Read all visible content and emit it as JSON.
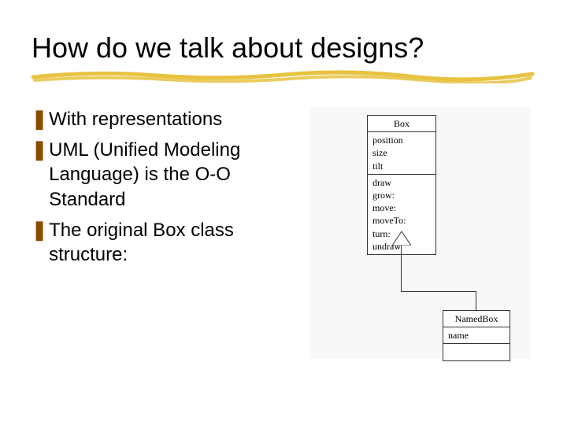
{
  "title": "How do we talk about designs?",
  "bullets": [
    "With representations",
    "UML (Unified Modeling Language) is the O-O Standard",
    "The original Box class structure:"
  ],
  "uml": {
    "box": {
      "name": "Box",
      "attributes": [
        "position",
        "size",
        "tilt"
      ],
      "methods": [
        "draw",
        "grow:",
        "move:",
        "moveTo:",
        "turn:",
        "undraw"
      ]
    },
    "namedbox": {
      "name": "NamedBox",
      "attributes": [
        "name"
      ],
      "methods": []
    }
  },
  "colors": {
    "underline": "#e8c242",
    "bullet_glyph": "#8b4b00"
  }
}
